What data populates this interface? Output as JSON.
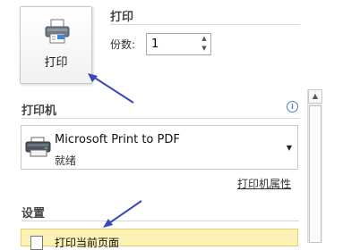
{
  "print_button": {
    "label": "打印"
  },
  "sections": {
    "print": "打印",
    "printer": "打印机",
    "settings": "设置"
  },
  "copies": {
    "label": "份数:",
    "value": "1"
  },
  "printer": {
    "name": "Microsoft Print to PDF",
    "status": "就绪",
    "properties_link": "打印机属性"
  },
  "settings": {
    "first_option": "打印当前页面"
  },
  "colors": {
    "arrow": "#3a46b8",
    "highlight": "#fdf2b5",
    "info": "#4a7ec6"
  }
}
